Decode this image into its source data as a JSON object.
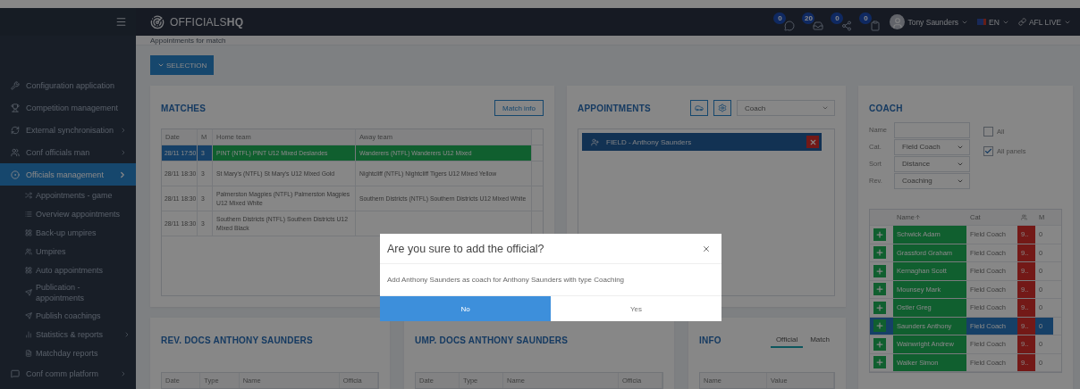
{
  "topbar": {
    "logo": "OFFICIALS**HQ**",
    "notifications": [
      {
        "count": "0"
      },
      {
        "count": "20"
      },
      {
        "count": "0"
      },
      {
        "count": "0"
      }
    ],
    "user": "Tony Saunders",
    "language": "EN",
    "organisation": "AFL LIVE"
  },
  "sidebar": {
    "items": [
      {
        "label": "Configuration application",
        "expandable": false,
        "selected": false
      },
      {
        "label": "Competition management",
        "expandable": false,
        "selected": false
      },
      {
        "label": "External synchronisation",
        "expandable": true,
        "selected": false
      },
      {
        "label": "Conf officials man",
        "expandable": true,
        "selected": false
      },
      {
        "label": "Officials management",
        "expandable": true,
        "selected": true,
        "children": [
          {
            "label": "Appointments - game",
            "selected": false
          },
          {
            "label": "Overview appointments",
            "selected": false
          },
          {
            "label": "Back-up umpires",
            "selected": false
          },
          {
            "label": "Umpires",
            "selected": false
          },
          {
            "label": "Auto appointments",
            "selected": false
          },
          {
            "label": "Publication - appointments",
            "selected": false
          },
          {
            "label": "Publish coachings",
            "selected": false
          },
          {
            "label": "Statistics & reports",
            "selected": false,
            "expandable": true
          },
          {
            "label": "Matchday reports",
            "selected": false
          }
        ]
      },
      {
        "label": "Conf comm platform",
        "expandable": true,
        "selected": false
      }
    ]
  },
  "breadcrumb": "Appointments for match",
  "selection_button": "SELECTION",
  "matches": {
    "title": "MATCHES",
    "info_button": "Match info",
    "columns": [
      "Date",
      "M",
      "Home team",
      "Away team"
    ],
    "rows": [
      {
        "date": "28/11 17:50",
        "m": "3",
        "home": "PINT (NTFL) PINT U12 Mixed Deslandes",
        "away": "Wanderers (NTFL) Wanderers U12 Mixed",
        "selected": true
      },
      {
        "date": "28/11 18:30",
        "m": "3",
        "home": "St Mary's (NTFL) St Mary's U12 Mixed Gold",
        "away": "Nightcliff (NTFL) Nightcliff Tigers U12 Mixed Yellow",
        "selected": false
      },
      {
        "date": "28/11 18:30",
        "m": "3",
        "home": "Palmerston Magpies (NTFL) Palmerston Magpies U12 Mixed White",
        "away": "Southern Districts (NTFL) Southern Districts U12 Mixed White",
        "selected": false
      },
      {
        "date": "28/11 18:30",
        "m": "3",
        "home": "Southern Districts (NTFL) Southern Districts U12 Mixed Black",
        "selected": false
      }
    ]
  },
  "appointments": {
    "title": "APPOINTMENTS",
    "type_select": "Coach",
    "items": [
      {
        "label": "FIELD - Anthony Saunders"
      }
    ]
  },
  "coach": {
    "title": "COACH",
    "filters": [
      {
        "label": "Name",
        "kind": "input"
      },
      {
        "label": "Cat.",
        "kind": "select",
        "value": "Field Coach"
      },
      {
        "label": "Sort",
        "kind": "select",
        "value": "Distance"
      },
      {
        "label": "Rev.",
        "kind": "select",
        "value": "Coaching"
      }
    ],
    "checkboxes": [
      {
        "label": "All",
        "checked": false
      },
      {
        "label": "All panels",
        "checked": true
      }
    ],
    "columns": {
      "name": "Name",
      "category": "Cat",
      "column_5": "M"
    },
    "rows": [
      {
        "name": "Schwick Adam",
        "category": "Field Coach",
        "column_4": "9..",
        "column_5": "0",
        "selected": false
      },
      {
        "name": "Grassford Graham",
        "category": "Field Coach",
        "column_4": "9..",
        "column_5": "0",
        "selected": false
      },
      {
        "name": "Kernaghan Scott",
        "category": "Field Coach",
        "column_4": "9..",
        "column_5": "0",
        "selected": false
      },
      {
        "name": "Mounsey Mark",
        "category": "Field Coach",
        "column_4": "9..",
        "column_5": "0",
        "selected": false
      },
      {
        "name": "Ostler Greg",
        "category": "Field Coach",
        "column_4": "9..",
        "column_5": "0",
        "selected": false
      },
      {
        "name": "Saunders Anthony",
        "category": "Field Coach",
        "column_4": "9..",
        "column_5": "0",
        "selected": true
      },
      {
        "name": "Wainwright Andrew",
        "category": "Field Coach",
        "column_4": "9..",
        "column_5": "0",
        "selected": false
      },
      {
        "name": "Walker Simon",
        "category": "Field Coach",
        "column_4": "9..",
        "column_5": "0",
        "selected": false
      }
    ]
  },
  "rev_docs": {
    "title": "REV. DOCS ANTHONY SAUNDERS",
    "columns": [
      "Date",
      "Type",
      "Name",
      "Officia"
    ]
  },
  "ump_docs": {
    "title": "UMP. DOCS ANTHONY SAUNDERS",
    "columns": [
      "Date",
      "Type",
      "Name",
      "Officia"
    ]
  },
  "info": {
    "title": "INFO",
    "tabs": [
      {
        "label": "Official",
        "selected": true
      },
      {
        "label": "Match",
        "selected": false
      }
    ],
    "columns": [
      "Name",
      "Value"
    ]
  },
  "dialog": {
    "title": "Are you sure to add the official?",
    "message": "Add Anthony Saunders as coach for Anthony Saunders with type Coaching",
    "buttons": [
      {
        "label": "No",
        "primary": true
      },
      {
        "label": "Yes",
        "primary": false
      }
    ]
  }
}
